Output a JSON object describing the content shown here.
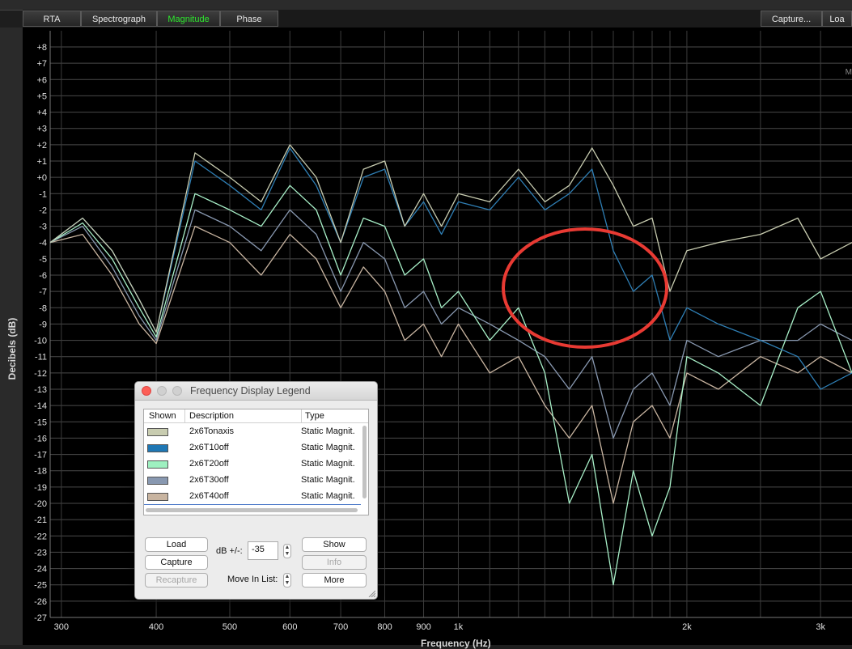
{
  "tabs": [
    {
      "label": "RTA",
      "active": false
    },
    {
      "label": "Spectrograph",
      "active": false
    },
    {
      "label": "Magnitude",
      "active": true
    },
    {
      "label": "Phase",
      "active": false
    }
  ],
  "right_tabs": {
    "capture": "Capture...",
    "load": "Loa"
  },
  "corner_text": "M",
  "axes": {
    "ylabel": "Decibels (dB)",
    "xlabel": "Frequency (Hz)",
    "yticks": [
      "+8",
      "+7",
      "+6",
      "+5",
      "+4",
      "+3",
      "+2",
      "+1",
      "+0",
      "-1",
      "-2",
      "-3",
      "-4",
      "-5",
      "-6",
      "-7",
      "-8",
      "-9",
      "-10",
      "-11",
      "-12",
      "-13",
      "-14",
      "-15",
      "-16",
      "-17",
      "-18",
      "-19",
      "-20",
      "-21",
      "-22",
      "-23",
      "-24",
      "-25",
      "-26",
      "-27"
    ],
    "xticks": [
      "300",
      "400",
      "500",
      "600",
      "700",
      "800",
      "900",
      "1k",
      "2k",
      "3k"
    ]
  },
  "chart_data": {
    "type": "line",
    "xlabel": "Frequency (Hz)",
    "ylabel": "Decibels (dB)",
    "x_scale": "log",
    "xlim": [
      290,
      3300
    ],
    "ylim": [
      -27,
      8
    ],
    "grid": true,
    "x": [
      290,
      320,
      350,
      380,
      400,
      450,
      500,
      550,
      600,
      650,
      700,
      750,
      800,
      850,
      900,
      950,
      1000,
      1100,
      1200,
      1300,
      1400,
      1500,
      1600,
      1700,
      1800,
      1900,
      2000,
      2200,
      2500,
      2800,
      3000,
      3300
    ],
    "series": [
      {
        "name": "2x6Tonaxis",
        "color": "#c8ccb0",
        "values": [
          -4,
          -2.5,
          -4.5,
          -7.5,
          -9.5,
          1.5,
          0,
          -1.5,
          2,
          0,
          -4,
          0.5,
          1,
          -3,
          -1,
          -3,
          -1,
          -1.5,
          0.5,
          -1.5,
          -0.5,
          1.8,
          -0.5,
          -3,
          -2.5,
          -7,
          -4.5,
          -4,
          -3.5,
          -2.5,
          -5,
          -4
        ]
      },
      {
        "name": "2x6T10off",
        "color": "#2f7fb5",
        "values": [
          -4,
          -2.5,
          -4.5,
          -7.5,
          -9.5,
          1,
          -0.5,
          -2,
          1.8,
          -0.5,
          -4,
          0,
          0.5,
          -3,
          -1.5,
          -3.5,
          -1.5,
          -2,
          0,
          -2,
          -1,
          0.5,
          -4.5,
          -7,
          -6,
          -10,
          -8,
          -9,
          -10,
          -11,
          -13,
          -12
        ]
      },
      {
        "name": "2x6T20off",
        "color": "#a8f0c8",
        "values": [
          -4,
          -2.8,
          -5,
          -8,
          -9.8,
          -1,
          -2,
          -3,
          -0.5,
          -2,
          -6,
          -2.5,
          -3,
          -6,
          -5,
          -8,
          -7,
          -10,
          -8,
          -12,
          -20,
          -17,
          -25,
          -18,
          -22,
          -19,
          -11,
          -12,
          -14,
          -8,
          -7,
          -12
        ]
      },
      {
        "name": "2x6T30off",
        "color": "#8898b0",
        "values": [
          -4,
          -3,
          -5.5,
          -8.5,
          -10,
          -2,
          -3,
          -4.5,
          -2,
          -3.5,
          -7,
          -4,
          -5,
          -8,
          -7,
          -9,
          -8,
          -9,
          -10,
          -11,
          -13,
          -11,
          -16,
          -13,
          -12,
          -14,
          -10,
          -11,
          -10,
          -10,
          -9,
          -10
        ]
      },
      {
        "name": "2x6T40off",
        "color": "#c8b4a0",
        "values": [
          -4,
          -3.5,
          -6,
          -9,
          -10.2,
          -3,
          -4,
          -6,
          -3.5,
          -5,
          -8,
          -5.5,
          -7,
          -10,
          -9,
          -11,
          -9,
          -12,
          -11,
          -14,
          -16,
          -14,
          -20,
          -15,
          -14,
          -16,
          -12,
          -13,
          -11,
          -12,
          -11,
          -12
        ]
      }
    ]
  },
  "legend": {
    "title": "Frequency Display Legend",
    "columns": [
      "Shown",
      "Description",
      "Type"
    ],
    "rows": [
      {
        "description": "2x6Tonaxis",
        "type": "Static Magnit.",
        "color": "#c8ccb0"
      },
      {
        "description": "2x6T10off",
        "type": "Static Magnit.",
        "color": "#1f77b4"
      },
      {
        "description": "2x6T20off",
        "type": "Static Magnit.",
        "color": "#9ef0c0"
      },
      {
        "description": "2x6T30off",
        "type": "Static Magnit.",
        "color": "#8898b0"
      },
      {
        "description": "2x6T40off",
        "type": "Static Magnit.",
        "color": "#c8b4a0"
      }
    ],
    "buttons": {
      "load": "Load",
      "capture": "Capture",
      "recapture": "Recapture",
      "show": "Show",
      "info": "Info",
      "more": "More"
    },
    "db_label": "dB +/-:",
    "db_value": "-35",
    "move_label": "Move In List:"
  },
  "annotation_color": "#e83a33"
}
